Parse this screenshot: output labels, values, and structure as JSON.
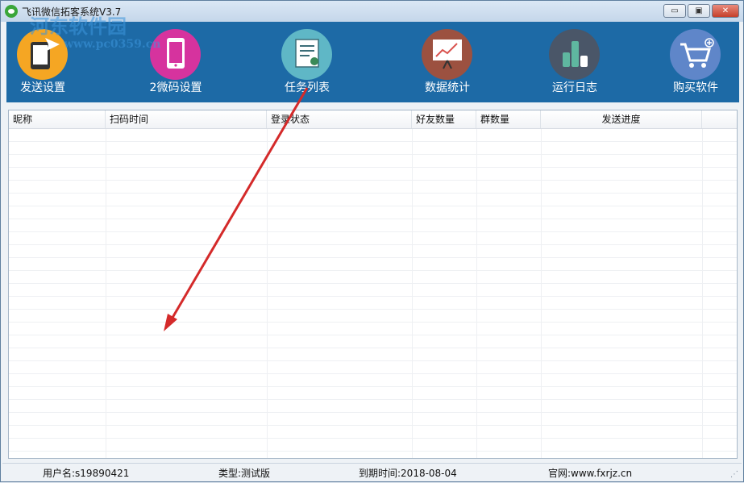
{
  "window": {
    "title": "飞讯微信拓客系统V3.7"
  },
  "watermark": {
    "line1": "河东软件园",
    "line2": "www.pc0359.cn"
  },
  "window_controls": {
    "minimize": "▭",
    "maximize": "▣",
    "close": "✕"
  },
  "toolbar": {
    "items": [
      {
        "label": "发送设置",
        "icon": "phone-send-icon",
        "color": "#f5a623"
      },
      {
        "label": "2微码设置",
        "icon": "mobile-phone-icon",
        "color": "#d6339e"
      },
      {
        "label": "任务列表",
        "icon": "certificate-list-icon",
        "color": "#5fb7c6"
      },
      {
        "label": "数据统计",
        "icon": "presentation-chart-icon",
        "color": "#9c5140"
      },
      {
        "label": "运行日志",
        "icon": "bar-chart-icon",
        "color": "#4a5668"
      },
      {
        "label": "购买软件",
        "icon": "shopping-cart-icon",
        "color": "#5f86c9"
      }
    ]
  },
  "table": {
    "columns": [
      "昵称",
      "扫码时间",
      "登录状态",
      "好友数量",
      "群数量",
      "发送进度"
    ],
    "rows": []
  },
  "status": {
    "user": "用户名:s19890421",
    "type": "类型:测试版",
    "expiry": "到期时间:2018-08-04",
    "website": "官网:www.fxrjz.cn"
  },
  "grip": "⋰"
}
